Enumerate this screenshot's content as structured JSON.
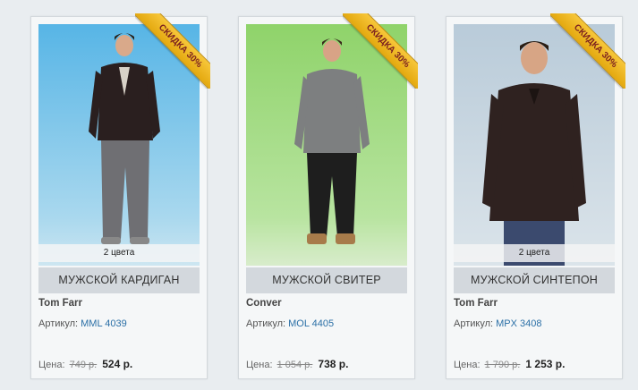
{
  "products": [
    {
      "badge": "СКИДКА 30%",
      "colors_note": "2 цвета",
      "name": "МУЖСКОЙ КАРДИГАН",
      "brand": "Tom Farr",
      "sku_label": "Артикул:",
      "sku": "MML 4039",
      "price_label": "Цена:",
      "old_price": "749 р.",
      "new_price": "524 р."
    },
    {
      "badge": "СКИДКА 30%",
      "colors_note": "",
      "name": "МУЖСКОЙ СВИТЕР",
      "brand": "Conver",
      "sku_label": "Артикул:",
      "sku": "MOL 4405",
      "price_label": "Цена:",
      "old_price": "1 054 р.",
      "new_price": "738 р."
    },
    {
      "badge": "СКИДКА 30%",
      "colors_note": "2 цвета",
      "name": "МУЖСКОЙ СИНТЕПОН",
      "brand": "Tom Farr",
      "sku_label": "Артикул:",
      "sku": "MPX 3408",
      "price_label": "Цена:",
      "old_price": "1 790 р.",
      "new_price": "1 253 р."
    }
  ],
  "colors": {
    "page_bg": "#e9edf0",
    "name_bar_bg": "#d3d8dd",
    "link": "#2a6fa6",
    "ribbon": "#f2b924",
    "ribbon_text": "#7a1f1f"
  }
}
